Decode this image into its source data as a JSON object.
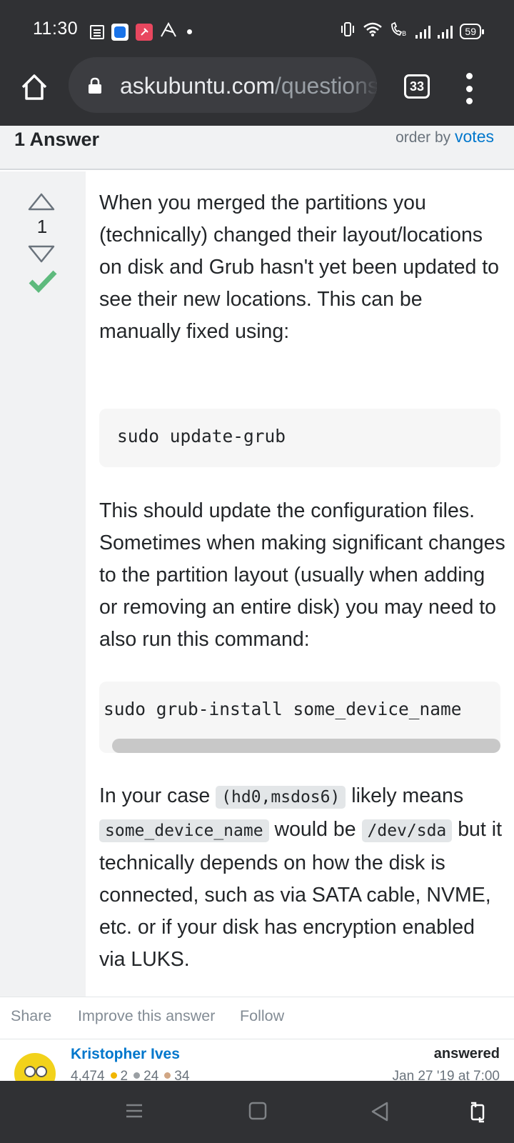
{
  "status_bar": {
    "time": "11:30",
    "battery": "59",
    "left_icons": [
      "news-icon",
      "app-blue-icon",
      "app-red-icon",
      "app-arrow-icon",
      "dot"
    ],
    "right_icons": [
      "vibrate-icon",
      "wifi-icon",
      "wifi-call-icon",
      "signal-icon",
      "signal-icon",
      "battery-icon"
    ]
  },
  "browser": {
    "url_host": "askubuntu.com",
    "url_path": "/questions",
    "tab_count": "33"
  },
  "answers_header": {
    "count_label": "1 Answer",
    "order_by_label": "order by",
    "order_by_value": "votes"
  },
  "answer": {
    "votes": "1",
    "accepted": true,
    "paragraph1": "When you merged the partitions you (technically) changed their layout/locations on disk and Grub hasn't yet been updated to see their new locations. This can be manually fixed using:",
    "code1": "sudo update-grub",
    "paragraph2": "This should update the configuration files. Sometimes when making significant changes to the partition layout (usually when adding or removing an entire disk) you may need to also run this command:",
    "code2": "sudo grub-install some_device_name",
    "p3_start": "In your case",
    "p3_code_a": "(hd0,msdos6)",
    "p3_mid1": "likely means",
    "p3_code_b": "some_device_name",
    "p3_mid2": "would be",
    "p3_code_c": "/dev/sda",
    "p3_end": "but it technically depends on how the disk is connected, such as via SATA cable, NVME, etc. or if your disk has encryption enabled via LUKS."
  },
  "post_menu": {
    "share": "Share",
    "improve": "Improve this answer",
    "follow": "Follow"
  },
  "user": {
    "name": "Kristopher Ives",
    "reputation": "4,474",
    "gold": "2",
    "silver": "24",
    "bronze": "34",
    "answered_label": "answered",
    "answered_date": "Jan 27 '19 at 7:00"
  },
  "colors": {
    "link": "#0077cc",
    "accepted_green": "#5eba7d",
    "gold": "#f1b600",
    "silver": "#9a9fa3",
    "bronze": "#d1a684"
  }
}
